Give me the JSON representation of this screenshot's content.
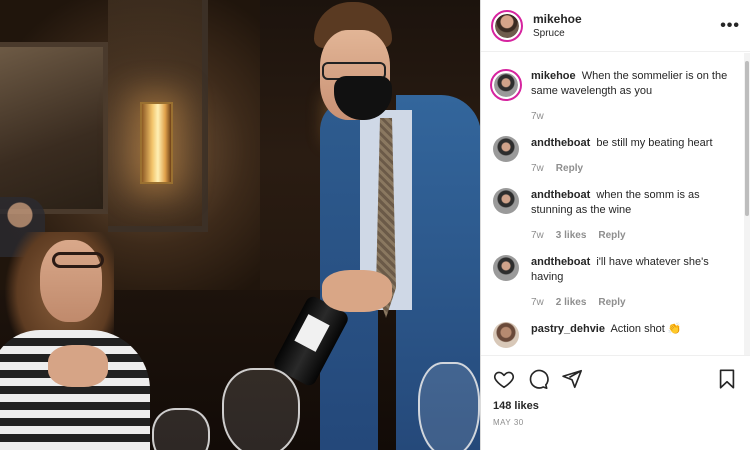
{
  "post": {
    "username": "mikehoe",
    "location": "Spruce",
    "more_icon": "more-horizontal-icon",
    "caption": {
      "username": "mikehoe",
      "text": "When the sommelier is on the same wavelength as you",
      "time": "7w"
    }
  },
  "comments": [
    {
      "username": "andtheboat",
      "text": "be still my beating heart",
      "time": "7w",
      "likes": "",
      "reply": "Reply"
    },
    {
      "username": "andtheboat",
      "text": "when the somm is as stunning as the wine",
      "time": "7w",
      "likes": "3 likes",
      "reply": "Reply"
    },
    {
      "username": "andtheboat",
      "text": "i'll have whatever she's having",
      "time": "7w",
      "likes": "2 likes",
      "reply": "Reply"
    },
    {
      "username": "pastry_dehvie",
      "text": "Action shot 👏",
      "time": "",
      "likes": "",
      "reply": ""
    }
  ],
  "actions": {
    "icons": [
      "heart-icon",
      "comment-icon",
      "share-icon",
      "bookmark-icon"
    ],
    "likes": "148 likes",
    "date": "MAY 30"
  },
  "colors": {
    "text": "#262626",
    "muted": "#8e8e8e",
    "border": "#dbdbdb",
    "story_ring": "#d6249f"
  }
}
